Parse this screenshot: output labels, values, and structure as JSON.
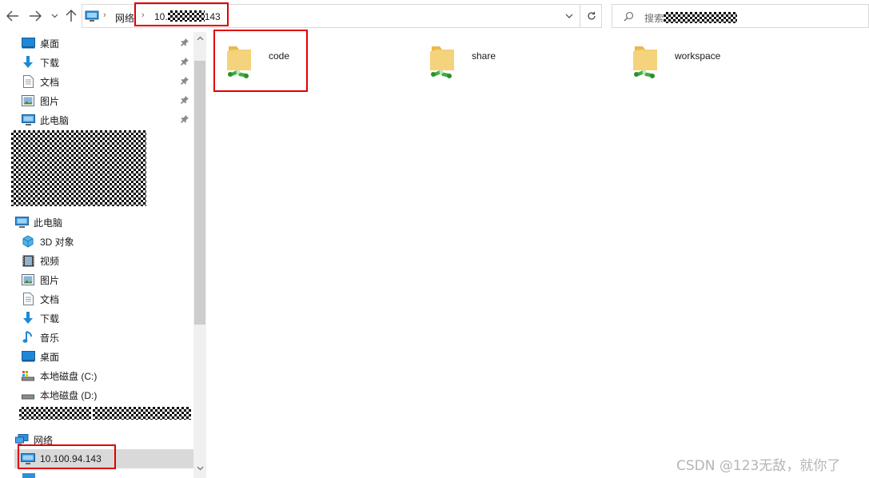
{
  "address": {
    "root": "网络",
    "host_prefix": "10.",
    "host_suffix": "143"
  },
  "search": {
    "placeholder_prefix": "搜索"
  },
  "sidebar": {
    "quick_access": [
      {
        "label": "桌面",
        "icon": "desktop-icon",
        "pinned": true
      },
      {
        "label": "下载",
        "icon": "download-icon",
        "pinned": true
      },
      {
        "label": "文档",
        "icon": "document-icon",
        "pinned": true
      },
      {
        "label": "图片",
        "icon": "picture-icon",
        "pinned": true
      },
      {
        "label": "此电脑",
        "icon": "computer-icon",
        "pinned": true
      }
    ],
    "this_pc": {
      "label": "此电脑",
      "items": [
        {
          "label": "3D 对象",
          "icon": "3d-objects-icon"
        },
        {
          "label": "视频",
          "icon": "video-icon"
        },
        {
          "label": "图片",
          "icon": "picture-icon"
        },
        {
          "label": "文档",
          "icon": "document-icon"
        },
        {
          "label": "下载",
          "icon": "download-icon"
        },
        {
          "label": "音乐",
          "icon": "music-icon"
        },
        {
          "label": "桌面",
          "icon": "desktop-icon"
        },
        {
          "label": "本地磁盘 (C:)",
          "icon": "drive-c-icon"
        },
        {
          "label": "本地磁盘 (D:)",
          "icon": "drive-d-icon"
        }
      ]
    },
    "network": {
      "label": "网络",
      "host": "10.100.94.143"
    }
  },
  "folders": [
    {
      "name": "code"
    },
    {
      "name": "share"
    },
    {
      "name": "workspace"
    }
  ],
  "watermark": "CSDN @123无敌，就你了",
  "colors": {
    "highlight_box": "#e00000",
    "selected_bg": "#d9d9d9",
    "folder_yellow": "#f4d27a",
    "network_green": "#3fae3f"
  }
}
